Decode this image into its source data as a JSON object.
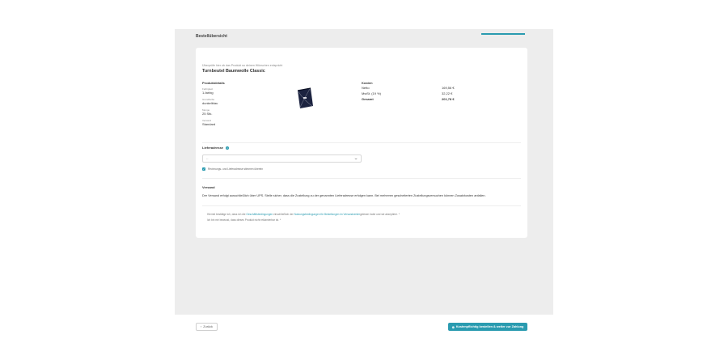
{
  "header": {
    "title": "Bestellübersicht",
    "progress": 1.0,
    "accent_color": "#2a9bb0"
  },
  "product": {
    "hint": "Überprüfe hier ob das Produkt so deinen Wünschen entspricht",
    "name": "Turnbeutel Baumwolle Classic",
    "image_icon": "drawstring-bag-icon"
  },
  "details": {
    "title": "Produktdetails",
    "items": [
      {
        "label": "Farbigkeit",
        "value": "1-farbig"
      },
      {
        "label": "Grundfarbe",
        "value": "dunkelblau"
      },
      {
        "label": "Menge",
        "value": "25 Stk."
      },
      {
        "label": "Versand",
        "value": "Standard"
      }
    ]
  },
  "costs": {
    "title": "Kosten",
    "rows": [
      {
        "label": "Netto",
        "amount": "169,56 €",
        "bold": false
      },
      {
        "label": "MwSt. (19 %)",
        "amount": "32,22 €",
        "bold": false
      },
      {
        "label": "Gesamt",
        "amount": "201,78 €",
        "bold": true
      }
    ]
  },
  "address": {
    "title": "Lieferadresse",
    "select_value": "--",
    "same_address_label": "Rechnungs- und Lieferadresse stimmen überein"
  },
  "shipping": {
    "title": "Versand",
    "text": "Der Versand erfolgt ausschließlich über UPS. Stelle sicher, dass die Zustellung zu der genannten Lieferadresse erfolgen kann. Bei mehreren gescheiterten Zustellungsversuchen können Zusatzkosten anfallen."
  },
  "terms": {
    "line1_a": "Hiermit bestätige ich, dass ich die",
    "link1": "Geschäftsbedingungen",
    "line1_b": "einschließlich der",
    "link2": "Nutzungsbedingungen für Bestellungen im Versandcenter",
    "line1_c": "gelesen habe und sie akzeptiere. *",
    "line2": "Ich bin mir bewusst, dass dieses Produkt nicht reklamierbar ist. *"
  },
  "footer": {
    "back_label": "Zurück",
    "order_label": "Kostenpflichtig bestellen & weiter zur Zahlung"
  }
}
